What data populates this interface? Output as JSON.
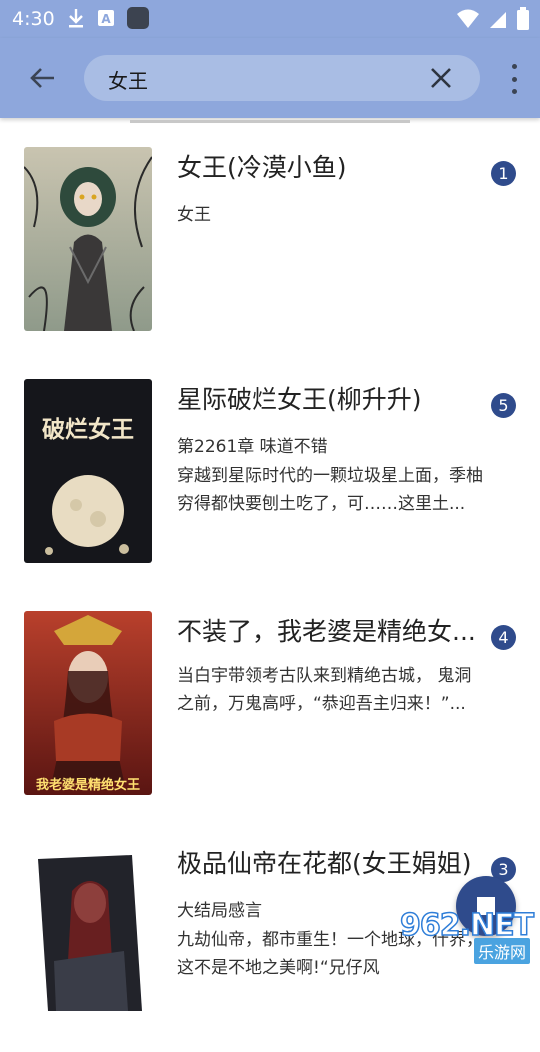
{
  "status_bar": {
    "time": "4:30",
    "left_icons": [
      "download-icon",
      "text-a-icon",
      "app-square-icon"
    ],
    "right_icons": [
      "wifi-icon",
      "signal-icon",
      "battery-icon"
    ]
  },
  "app_bar": {
    "back_icon": "arrow-back-icon",
    "search_value": "女王",
    "clear_icon": "close-icon",
    "menu_icon": "more-vert-icon",
    "color": "#8ea7dc"
  },
  "books": [
    {
      "title": "女王(冷漠小鱼)",
      "subtitle": "女王",
      "description": "",
      "badge": "1",
      "cover_text": ""
    },
    {
      "title": "星际破烂女王(柳升升)",
      "subtitle": "第2261章 味道不错",
      "description": "穿越到星际时代的一颗垃圾星上面，季柚穷得都快要刨土吃了，可……这里土...",
      "badge": "5",
      "cover_text": "破烂女王"
    },
    {
      "title": "不装了，我老婆是精绝女...",
      "subtitle": "",
      "description": "当白宇带领考古队来到精绝古城， 鬼洞之前，万鬼高呼，“恭迎吾主归来！”...",
      "badge": "4",
      "cover_text": "我老婆是精绝女王"
    },
    {
      "title": "极品仙帝在花都(女王娟姐)",
      "subtitle": "大结局感言",
      "description": "九劫仙帝，都市重生！一个地球，什界，这不是不地之美啊!“兄仔风",
      "badge": "3",
      "cover_text": ""
    }
  ],
  "fab": {
    "icon": "stop-square-icon"
  },
  "watermark": {
    "logo": "962.NET",
    "text": "乐游网"
  },
  "colors": {
    "accent": "#2f4b8c",
    "toolbar": "#8ea7dc"
  }
}
